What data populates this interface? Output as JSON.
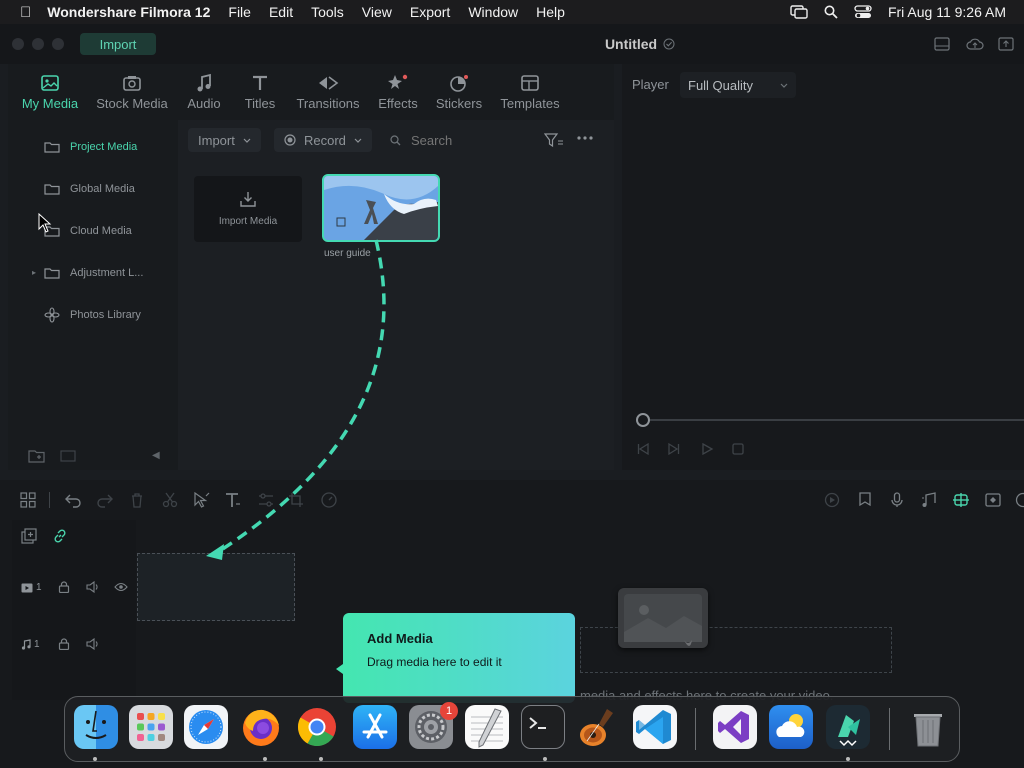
{
  "menubar": {
    "app_name": "Wondershare Filmora 12",
    "items": [
      "File",
      "Edit",
      "Tools",
      "View",
      "Export",
      "Window",
      "Help"
    ],
    "clock": "Fri Aug 11  9:26 AM",
    "icons": [
      "apple-logo-icon",
      "screen-mirroring-icon",
      "spotlight-search-icon",
      "control-center-icon"
    ]
  },
  "window": {
    "import_tab": "Import",
    "doc_title": "Untitled"
  },
  "media_tabs": [
    {
      "label": "My Media",
      "icon": "my-media-icon",
      "active": true
    },
    {
      "label": "Stock Media",
      "icon": "stock-media-icon"
    },
    {
      "label": "Audio",
      "icon": "audio-note-icon"
    },
    {
      "label": "Titles",
      "icon": "titles-t-icon"
    },
    {
      "label": "Transitions",
      "icon": "transitions-icon"
    },
    {
      "label": "Effects",
      "icon": "effects-icon"
    },
    {
      "label": "Stickers",
      "icon": "stickers-icon"
    },
    {
      "label": "Templates",
      "icon": "templates-icon"
    }
  ],
  "sidebar": {
    "items": [
      {
        "label": "Project Media",
        "icon": "folder-icon",
        "active": true
      },
      {
        "label": "Global Media",
        "icon": "folder-icon"
      },
      {
        "label": "Cloud Media",
        "icon": "folder-icon"
      },
      {
        "label": "Adjustment L...",
        "icon": "folder-icon"
      },
      {
        "label": "Photos Library",
        "icon": "photos-icon"
      }
    ]
  },
  "library_toolbar": {
    "import_label": "Import",
    "record_label": "Record",
    "search_placeholder": "Search"
  },
  "library": {
    "import_media_label": "Import Media",
    "clip_name": "user guide"
  },
  "player": {
    "label": "Player",
    "quality": "Full Quality",
    "progress": 0
  },
  "timeline": {
    "video_track": "1",
    "audio_track": "1",
    "hint_text": "media and effects here to create your video."
  },
  "tooltip": {
    "title": "Add Media",
    "text": "Drag media here to edit it"
  },
  "dock": {
    "apps": [
      "Finder",
      "Launchpad",
      "Safari",
      "Firefox",
      "Chrome",
      "App Store",
      "System Settings",
      "TextEdit",
      "Terminal",
      "GarageBand",
      "Visual Studio Code",
      "Visual Studio",
      "Weather",
      "Filmora",
      "Trash"
    ],
    "settings_badge": "1"
  },
  "colors": {
    "accent": "#4ad5ad",
    "tooltip_gradient": [
      "#44e6b0",
      "#5bd3de"
    ]
  }
}
